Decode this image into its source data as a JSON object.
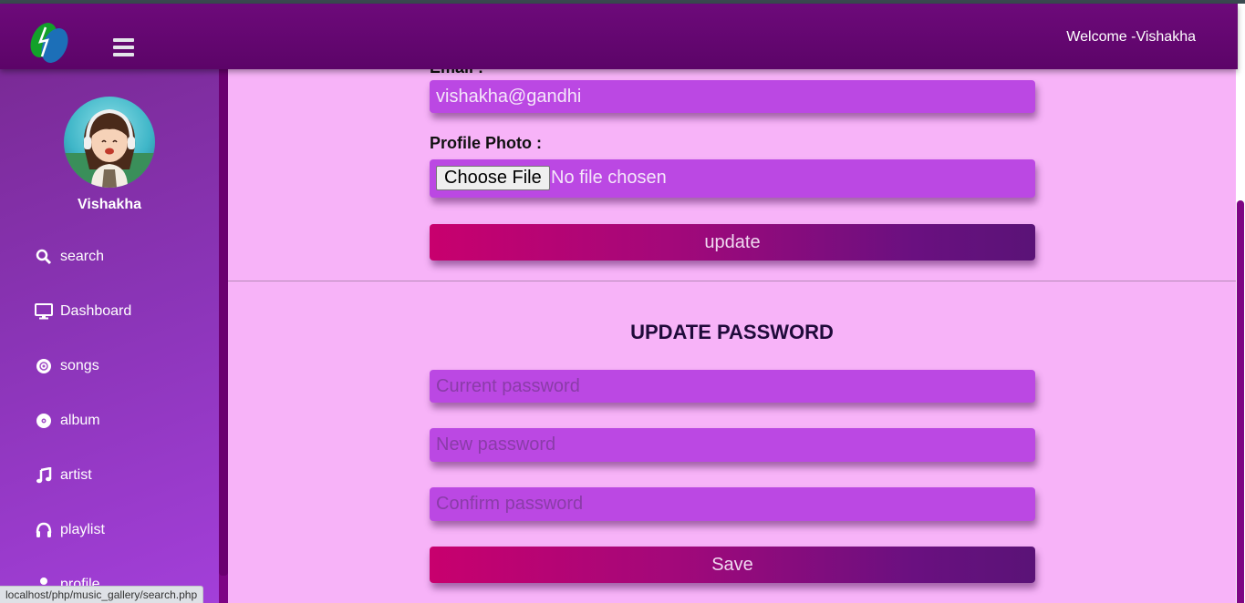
{
  "header": {
    "welcome": "Welcome -Vishakha",
    "colors": {
      "header": "#6d0a7a",
      "sidebar": "#8a34b6",
      "page": "#f7b3f8",
      "field": "#bb48e3",
      "button_start": "#c8006e",
      "button_end": "#5a1377"
    }
  },
  "sidebar": {
    "username": "Vishakha",
    "items": [
      {
        "label": "search",
        "icon": "search-icon"
      },
      {
        "label": "Dashboard",
        "icon": "monitor-icon"
      },
      {
        "label": "songs",
        "icon": "disc-icon"
      },
      {
        "label": "album",
        "icon": "album-disc-icon"
      },
      {
        "label": "artist",
        "icon": "music-note-icon"
      },
      {
        "label": "playlist",
        "icon": "headphones-icon"
      },
      {
        "label": "profile",
        "icon": "user-icon"
      }
    ]
  },
  "profile_form": {
    "email_label": "Email :",
    "email_value": "vishakha@gandhi",
    "photo_label": "Profile Photo :",
    "choose_file": "Choose File",
    "no_file": "No file chosen",
    "update_button": "update"
  },
  "password_form": {
    "title": "UPDATE PASSWORD",
    "current_placeholder": "Current password",
    "new_placeholder": "New password",
    "confirm_placeholder": "Confirm password",
    "save_button": "Save"
  },
  "status_bar": {
    "url": "localhost/php/music_gallery/search.php"
  }
}
